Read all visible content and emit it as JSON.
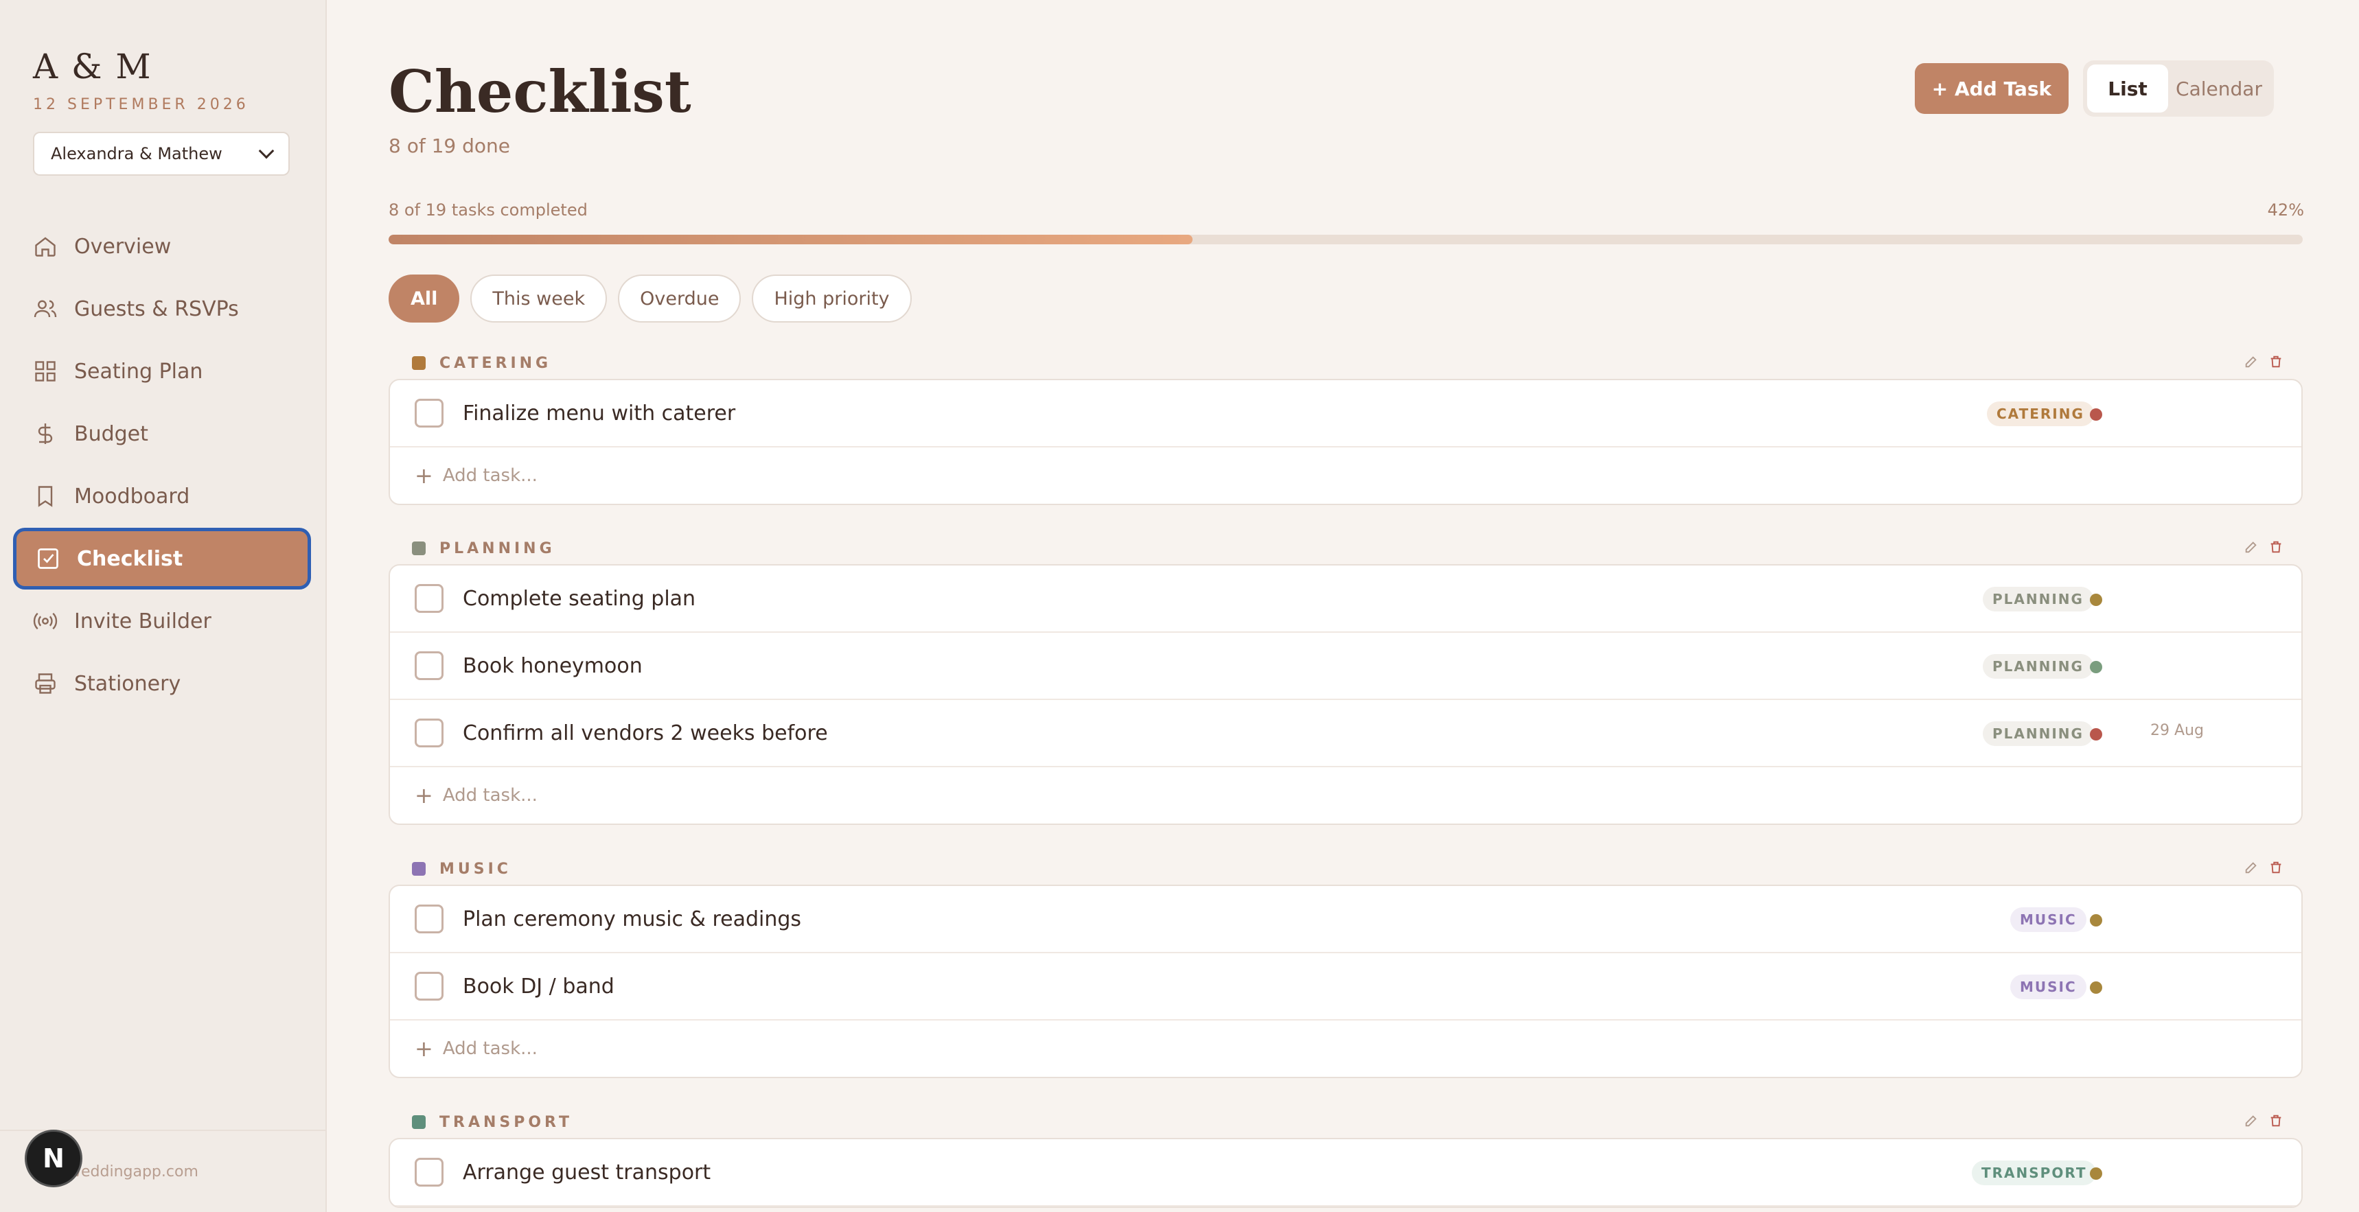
{
  "sidebar": {
    "brand": "A & M",
    "date": "12 SEPTEMBER 2026",
    "couple": "Alexandra & Mathew",
    "items": [
      {
        "label": "Overview"
      },
      {
        "label": "Guests & RSVPs"
      },
      {
        "label": "Seating Plan"
      },
      {
        "label": "Budget"
      },
      {
        "label": "Moodboard"
      },
      {
        "label": "Checklist"
      },
      {
        "label": "Invite Builder"
      },
      {
        "label": "Stationery"
      }
    ],
    "footer": "weddingapp.com",
    "badge": "N"
  },
  "header": {
    "title": "Checklist",
    "subtitle": "8 of 19 done",
    "add_task": "+ Add Task",
    "view_list": "List",
    "view_calendar": "Calendar"
  },
  "progress": {
    "label": "8 of 19 tasks completed",
    "percent": "42%",
    "fraction": 0.42
  },
  "filters": [
    "All",
    "This week",
    "Overdue",
    "High priority"
  ],
  "add_task_placeholder": "Add task...",
  "groups": [
    {
      "name": "CATERING",
      "color": "#b07a3c",
      "tasks": [
        {
          "text": "Finalize menu with caterer",
          "tag": "CATERING",
          "dot": "#b9574c",
          "due": ""
        }
      ]
    },
    {
      "name": "PLANNING",
      "color": "#8a8f7e",
      "tasks": [
        {
          "text": "Complete seating plan",
          "tag": "PLANNING",
          "dot": "#a8873c",
          "due": ""
        },
        {
          "text": "Book honeymoon",
          "tag": "PLANNING",
          "dot": "#7a9d7e",
          "due": ""
        },
        {
          "text": "Confirm all vendors 2 weeks before",
          "tag": "PLANNING",
          "dot": "#b9574c",
          "due": "29 Aug"
        }
      ]
    },
    {
      "name": "MUSIC",
      "color": "#8d74b3",
      "tasks": [
        {
          "text": "Plan ceremony music & readings",
          "tag": "MUSIC",
          "dot": "#a8873c",
          "due": ""
        },
        {
          "text": "Book DJ / band",
          "tag": "MUSIC",
          "dot": "#a8873c",
          "due": ""
        }
      ]
    },
    {
      "name": "TRANSPORT",
      "color": "#5f8f7c",
      "tasks": [
        {
          "text": "Arrange guest transport",
          "tag": "TRANSPORT",
          "dot": "#a8873c",
          "due": ""
        }
      ]
    }
  ]
}
